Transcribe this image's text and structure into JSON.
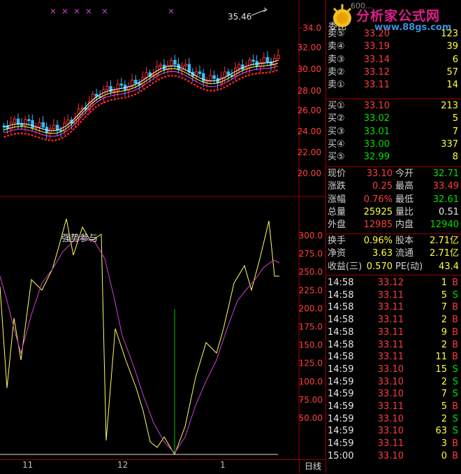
{
  "logo": {
    "text": "分析家公式网",
    "url": "www.88gs.com"
  },
  "ticker_partial": "600...",
  "chart": {
    "price_axis": [
      "34.0",
      "32.00",
      "30.00",
      "28.00",
      "26.00",
      "24.00",
      "22.00",
      "20.00"
    ],
    "indicator_axis": [
      "300.0",
      "275.0",
      "250.0",
      "225.0",
      "200.0",
      "175.0",
      "150.0",
      "125.0",
      "100.0",
      "75.00",
      "50.00"
    ],
    "high_marker": "35.46",
    "indicator_name": "强势参与",
    "date_labels": [
      "11",
      "12",
      "1"
    ],
    "period": "日线"
  },
  "quote": {
    "header_label": "委比",
    "asks": [
      {
        "label": "卖⑤",
        "price": "33.20",
        "vol": "123"
      },
      {
        "label": "卖④",
        "price": "33.19",
        "vol": "39"
      },
      {
        "label": "卖③",
        "price": "33.14",
        "vol": "6"
      },
      {
        "label": "卖②",
        "price": "33.12",
        "vol": "57"
      },
      {
        "label": "卖①",
        "price": "33.11",
        "vol": "14"
      }
    ],
    "bids": [
      {
        "label": "买①",
        "price": "33.10",
        "vol": "213"
      },
      {
        "label": "买②",
        "price": "33.02",
        "vol": "5"
      },
      {
        "label": "买③",
        "price": "33.01",
        "vol": "7"
      },
      {
        "label": "买④",
        "price": "33.00",
        "vol": "337"
      },
      {
        "label": "买⑤",
        "price": "32.99",
        "vol": "8"
      }
    ],
    "stats": [
      {
        "l1": "现价",
        "v1": "33.10",
        "c1": "red",
        "l2": "今开",
        "v2": "32.71",
        "c2": "green"
      },
      {
        "l1": "涨跌",
        "v1": "0.25",
        "c1": "red",
        "l2": "最高",
        "v2": "33.49",
        "c2": "red"
      },
      {
        "l1": "涨幅",
        "v1": "0.76%",
        "c1": "red",
        "l2": "最低",
        "v2": "32.61",
        "c2": "green"
      },
      {
        "l1": "总量",
        "v1": "25925",
        "c1": "yellow",
        "l2": "量比",
        "v2": "0.51",
        "c2": "white"
      },
      {
        "l1": "外盘",
        "v1": "12985",
        "c1": "red",
        "l2": "内盘",
        "v2": "12940",
        "c2": "green"
      }
    ],
    "fundamentals": [
      {
        "l1": "换手",
        "v1": "0.96%",
        "l2": "股本",
        "v2": "2.71亿"
      },
      {
        "l1": "净资",
        "v1": "3.63",
        "l2": "流通",
        "v2": "2.71亿"
      },
      {
        "l1": "收益(三)",
        "v1": "0.570",
        "l2": "PE(动)",
        "v2": "43.4"
      }
    ],
    "ticks": [
      {
        "time": "14:58",
        "price": "33.12",
        "vol": "1",
        "side": "B"
      },
      {
        "time": "14:58",
        "price": "33.11",
        "vol": "5",
        "side": "S"
      },
      {
        "time": "14:58",
        "price": "33.11",
        "vol": "7",
        "side": "B"
      },
      {
        "time": "14:58",
        "price": "33.11",
        "vol": "2",
        "side": "B"
      },
      {
        "time": "14:58",
        "price": "33.11",
        "vol": "9",
        "side": "B"
      },
      {
        "time": "14:58",
        "price": "33.11",
        "vol": "2",
        "side": "B"
      },
      {
        "time": "14:58",
        "price": "33.11",
        "vol": "11",
        "side": "B"
      },
      {
        "time": "14:59",
        "price": "33.10",
        "vol": "15",
        "side": "S"
      },
      {
        "time": "14:59",
        "price": "33.10",
        "vol": "2",
        "side": "S"
      },
      {
        "time": "14:59",
        "price": "33.10",
        "vol": "7",
        "side": "S"
      },
      {
        "time": "14:59",
        "price": "33.11",
        "vol": "5",
        "side": "B"
      },
      {
        "time": "14:59",
        "price": "33.10",
        "vol": "2",
        "side": "S"
      },
      {
        "time": "14:59",
        "price": "33.10",
        "vol": "63",
        "side": "S"
      },
      {
        "time": "14:59",
        "price": "33.11",
        "vol": "3",
        "side": "B"
      },
      {
        "time": "15:00",
        "price": "33.10",
        "vol": "0",
        "side": "B"
      }
    ]
  }
}
